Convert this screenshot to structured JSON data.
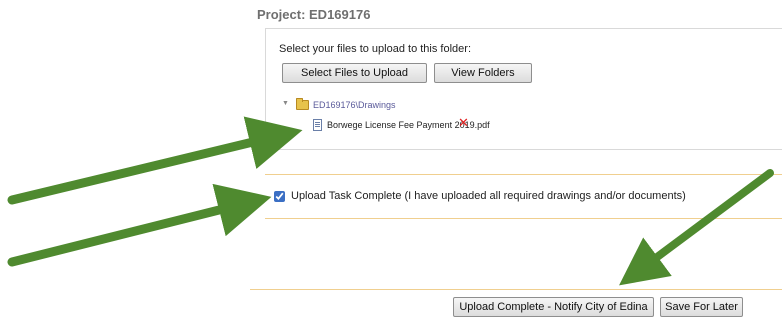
{
  "project": {
    "title": "Project: ED169176"
  },
  "upload": {
    "prompt": "Select your files to upload to this folder:",
    "select_files_label": "Select Files to Upload",
    "view_folders_label": "View Folders"
  },
  "tree": {
    "folder_label": "ED169176\\Drawings",
    "files": [
      {
        "name": "Borwege License Fee Payment 2019.pdf",
        "remove_icon": "red-x-icon"
      }
    ]
  },
  "task": {
    "checked": true,
    "label": "Upload Task Complete (I have uploaded all required drawings and/or documents)"
  },
  "footer": {
    "notify_label": "Upload Complete - Notify City of Edina",
    "save_label": "Save For Later"
  },
  "colors": {
    "arrow": "#4f8a2f",
    "divider": "#f0cf8f",
    "remove": "#e02020",
    "folder_link": "#5a5a9a"
  }
}
